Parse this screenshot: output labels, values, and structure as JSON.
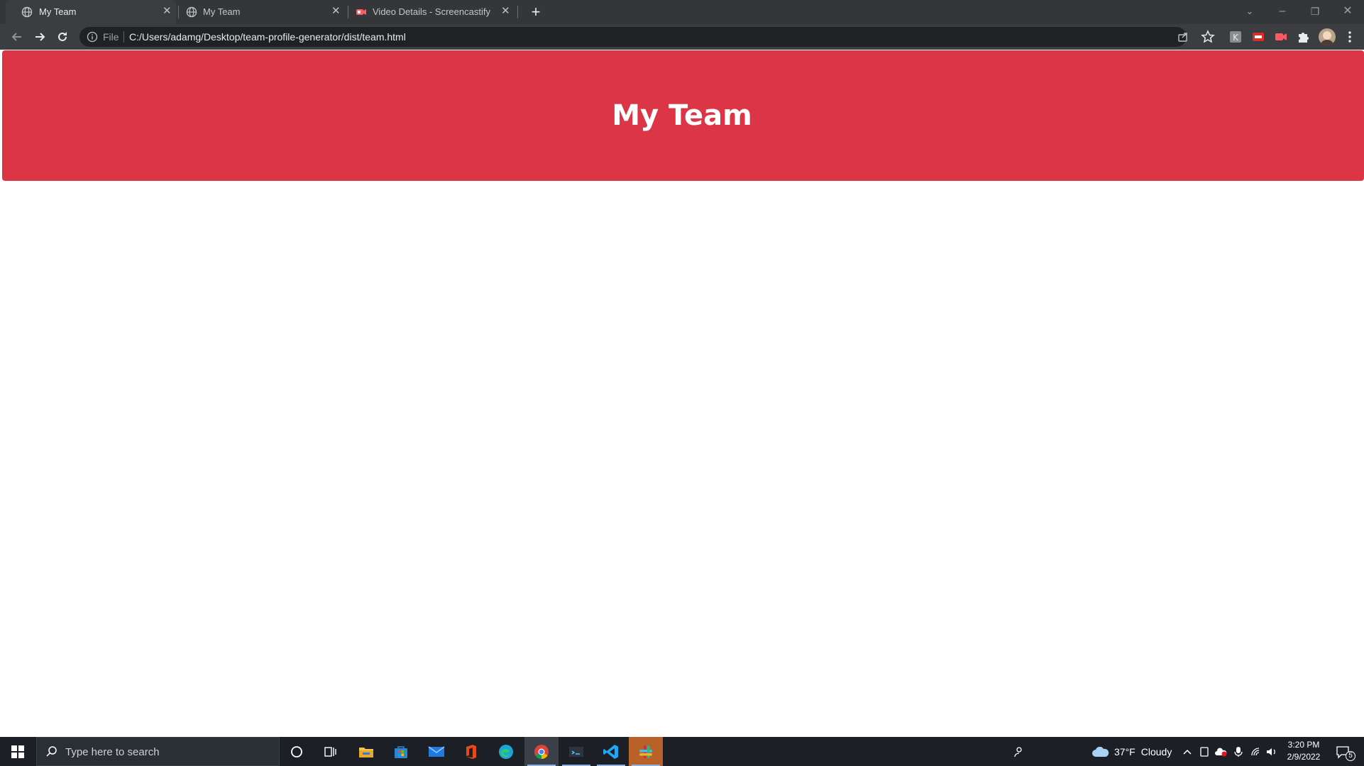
{
  "browser": {
    "tabs": [
      {
        "title": "My Team",
        "active": true
      },
      {
        "title": "My Team",
        "active": false
      },
      {
        "title": "Video Details - Screencastify",
        "active": false
      }
    ],
    "omnibox": {
      "scheme_label": "File",
      "url": "C:/Users/adamg/Desktop/team-profile-generator/dist/team.html"
    }
  },
  "page": {
    "header_title": "My Team",
    "header_color": "#dc3545"
  },
  "taskbar": {
    "search_placeholder": "Type here to search",
    "weather": {
      "temp": "37°F",
      "condition": "Cloudy"
    },
    "clock": {
      "time": "3:20 PM",
      "date": "2/9/2022"
    },
    "notification_count": "5",
    "pinned_apps": [
      "cortana-icon",
      "task-view-icon",
      "file-explorer-icon",
      "microsoft-store-icon",
      "mail-icon",
      "office-icon",
      "edge-icon",
      "chrome-icon",
      "terminal-icon",
      "vscode-icon",
      "slack-icon"
    ]
  }
}
